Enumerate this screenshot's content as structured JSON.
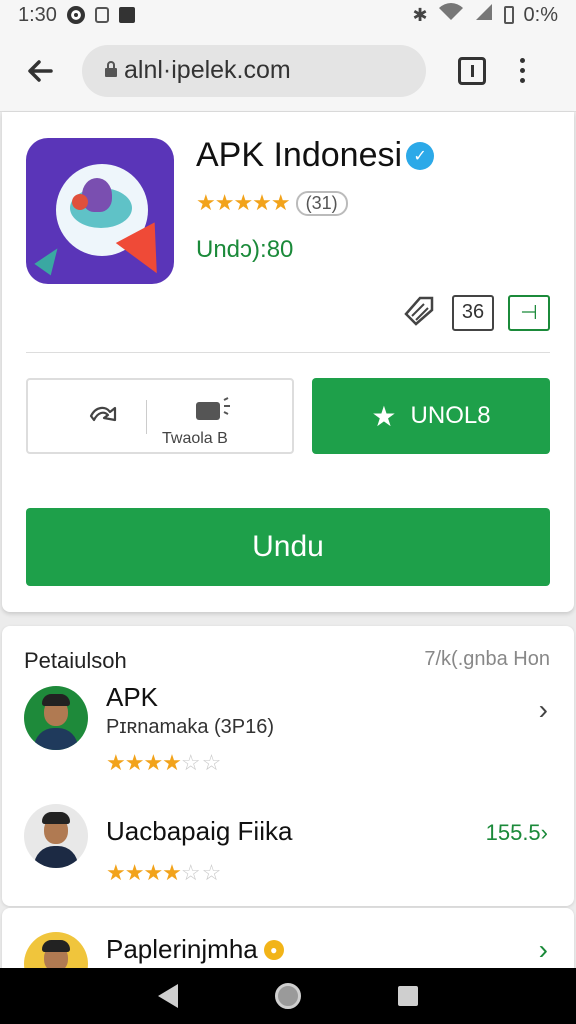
{
  "status_bar": {
    "time": "1:30",
    "battery_text": "0:%"
  },
  "browser": {
    "url": "alnl·ipelek.com",
    "back_icon": "arrow-left-icon",
    "lock_icon": "lock-icon",
    "tabs_icon": "tabs-icon",
    "menu_icon": "more-vert-icon"
  },
  "app": {
    "title": "APK Indonesi",
    "rating_count": "31",
    "rating_stars": 5,
    "downloads_text": "Undɔ):80",
    "meta": {
      "box1": "36",
      "box2": "⊣"
    },
    "share_label": "Twaola B",
    "wishlist_label": "UNOL8",
    "download_label": "Undu",
    "accent_color": "#1ea04a"
  },
  "list": {
    "header": "Petaiulsoh",
    "header_right": "7/k(.gnba Hon",
    "items": [
      {
        "title": "APK",
        "subtitle": "Pɪʀnamaka (3P16)",
        "stars_filled": 4,
        "stars_total": 6,
        "trailing": "›"
      },
      {
        "title": "Uacbapaig Fiika",
        "stars_filled": 4,
        "stars_total": 6,
        "trailing": "155.5›"
      }
    ]
  },
  "third_item": {
    "title": "Paplerinjmha",
    "trailing": "›"
  }
}
